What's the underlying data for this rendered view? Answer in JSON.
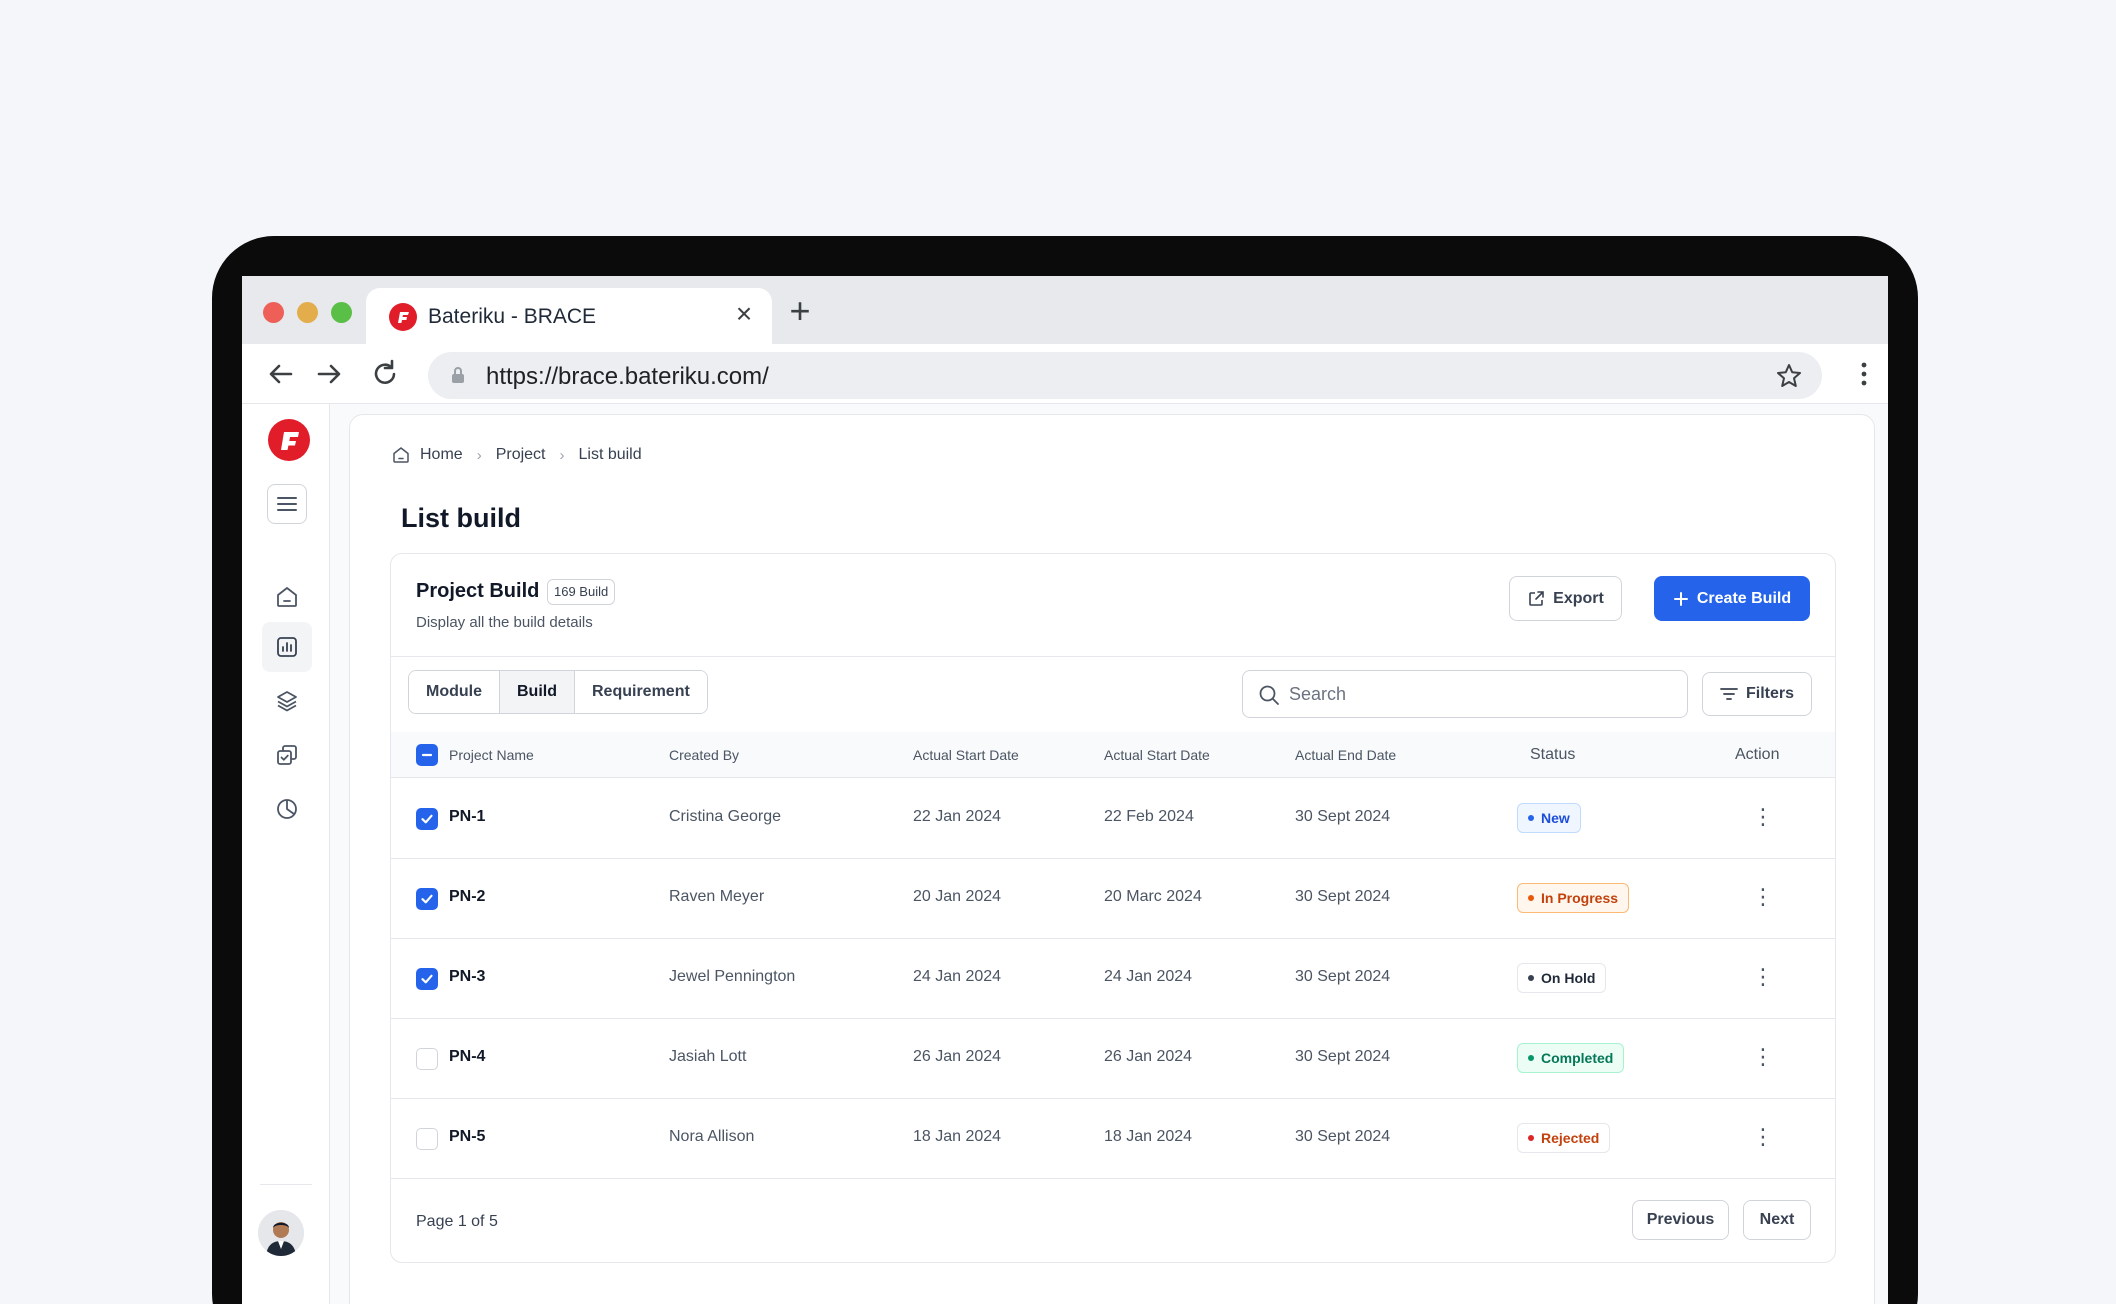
{
  "browser": {
    "tab_title": "Bateriku - BRACE",
    "url": "https://brace.bateriku.com/"
  },
  "breadcrumb": [
    "Home",
    "Project",
    "List build"
  ],
  "page_title": "List build",
  "card": {
    "title": "Project Build",
    "count_badge": "169 Build",
    "subtitle": "Display all the build details",
    "export_label": "Export",
    "create_label": "Create Build"
  },
  "tabs": [
    {
      "label": "Module",
      "active": false
    },
    {
      "label": "Build",
      "active": true
    },
    {
      "label": "Requirement",
      "active": false
    }
  ],
  "search": {
    "placeholder": "Search",
    "value": ""
  },
  "filters_label": "Filters",
  "table": {
    "columns": [
      "Project Name",
      "Created By",
      "Actual Start Date",
      "Actual Start Date",
      "Actual End Date",
      "Status",
      "Action"
    ],
    "rows": [
      {
        "checked": true,
        "name": "PN-1",
        "created_by": "Cristina George",
        "start1": "22 Jan 2024",
        "start2": "22 Feb 2024",
        "end": "30 Sept 2024",
        "status": "New"
      },
      {
        "checked": true,
        "name": "PN-2",
        "created_by": "Raven Meyer",
        "start1": "20 Jan 2024",
        "start2": "20 Marc 2024",
        "end": "30 Sept 2024",
        "status": "In Progress"
      },
      {
        "checked": true,
        "name": "PN-3",
        "created_by": "Jewel Pennington",
        "start1": "24 Jan 2024",
        "start2": "24 Jan 2024",
        "end": "30 Sept 2024",
        "status": "On Hold"
      },
      {
        "checked": false,
        "name": "PN-4",
        "created_by": "Jasiah Lott",
        "start1": "26 Jan 2024",
        "start2": "26 Jan 2024",
        "end": "30 Sept 2024",
        "status": "Completed"
      },
      {
        "checked": false,
        "name": "PN-5",
        "created_by": "Nora Allison",
        "start1": "18 Jan 2024",
        "start2": "18 Jan 2024",
        "end": "30 Sept 2024",
        "status": "Rejected"
      }
    ]
  },
  "status_colors": {
    "New": {
      "text": "#1d4ed8",
      "bg": "#eff6ff",
      "border": "#bfdbfe",
      "dot": "#2563eb"
    },
    "In Progress": {
      "text": "#c2410c",
      "bg": "#fff7ed",
      "border": "#fdba74",
      "dot": "#ea580c"
    },
    "On Hold": {
      "text": "#1f2937",
      "bg": "#ffffff",
      "border": "#e5e7eb",
      "dot": "#374151"
    },
    "Completed": {
      "text": "#047857",
      "bg": "#ecfdf5",
      "border": "#a7f3d0",
      "dot": "#059669"
    },
    "Rejected": {
      "text": "#c2410c",
      "bg": "#ffffff",
      "border": "#e5e7eb",
      "dot": "#dc2626"
    }
  },
  "pagination": {
    "info": "Page 1 of 5",
    "previous": "Previous",
    "next": "Next"
  },
  "colors": {
    "accent": "#2563eb",
    "brand": "#e11d2a"
  },
  "icons": {
    "sidebar": [
      "home-icon",
      "chart-icon",
      "layers-icon",
      "copy-check-icon",
      "pie-chart-icon"
    ],
    "row_action": "more-vertical-icon"
  }
}
